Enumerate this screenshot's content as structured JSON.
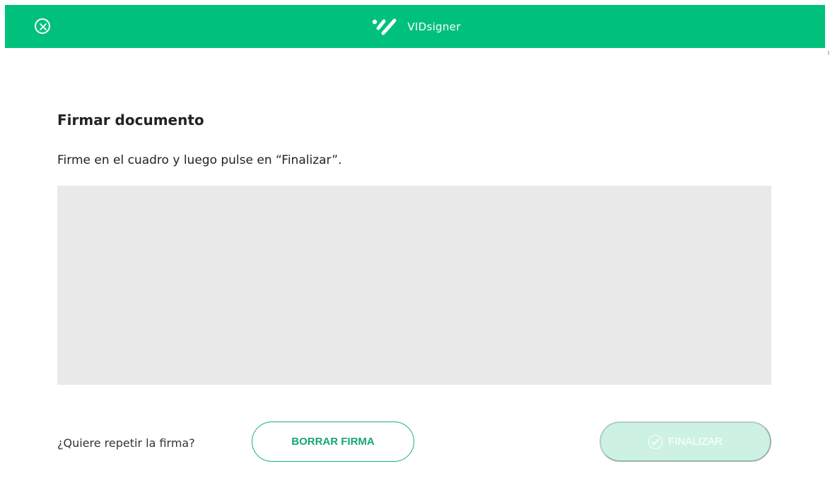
{
  "header": {
    "brand": "VIDsigner",
    "logo_icon": "vidsigner-logo-icon",
    "close_icon": "close-circle-icon",
    "color": "#00c17c"
  },
  "main": {
    "title": "Firmar documento",
    "instructions": "Firme en el cuadro y luego pulse en “Finalizar”.",
    "signature_pad_color": "#e9e9e9"
  },
  "footer": {
    "repeat_question": "¿Quiere repetir la firma?",
    "clear_button": "BORRAR FIRMA",
    "finish_button": "FINALIZAR",
    "finish_icon": "check-circle-icon",
    "finish_enabled": false,
    "accent_color": "#14a67a",
    "disabled_color": "#cdf2e4"
  }
}
